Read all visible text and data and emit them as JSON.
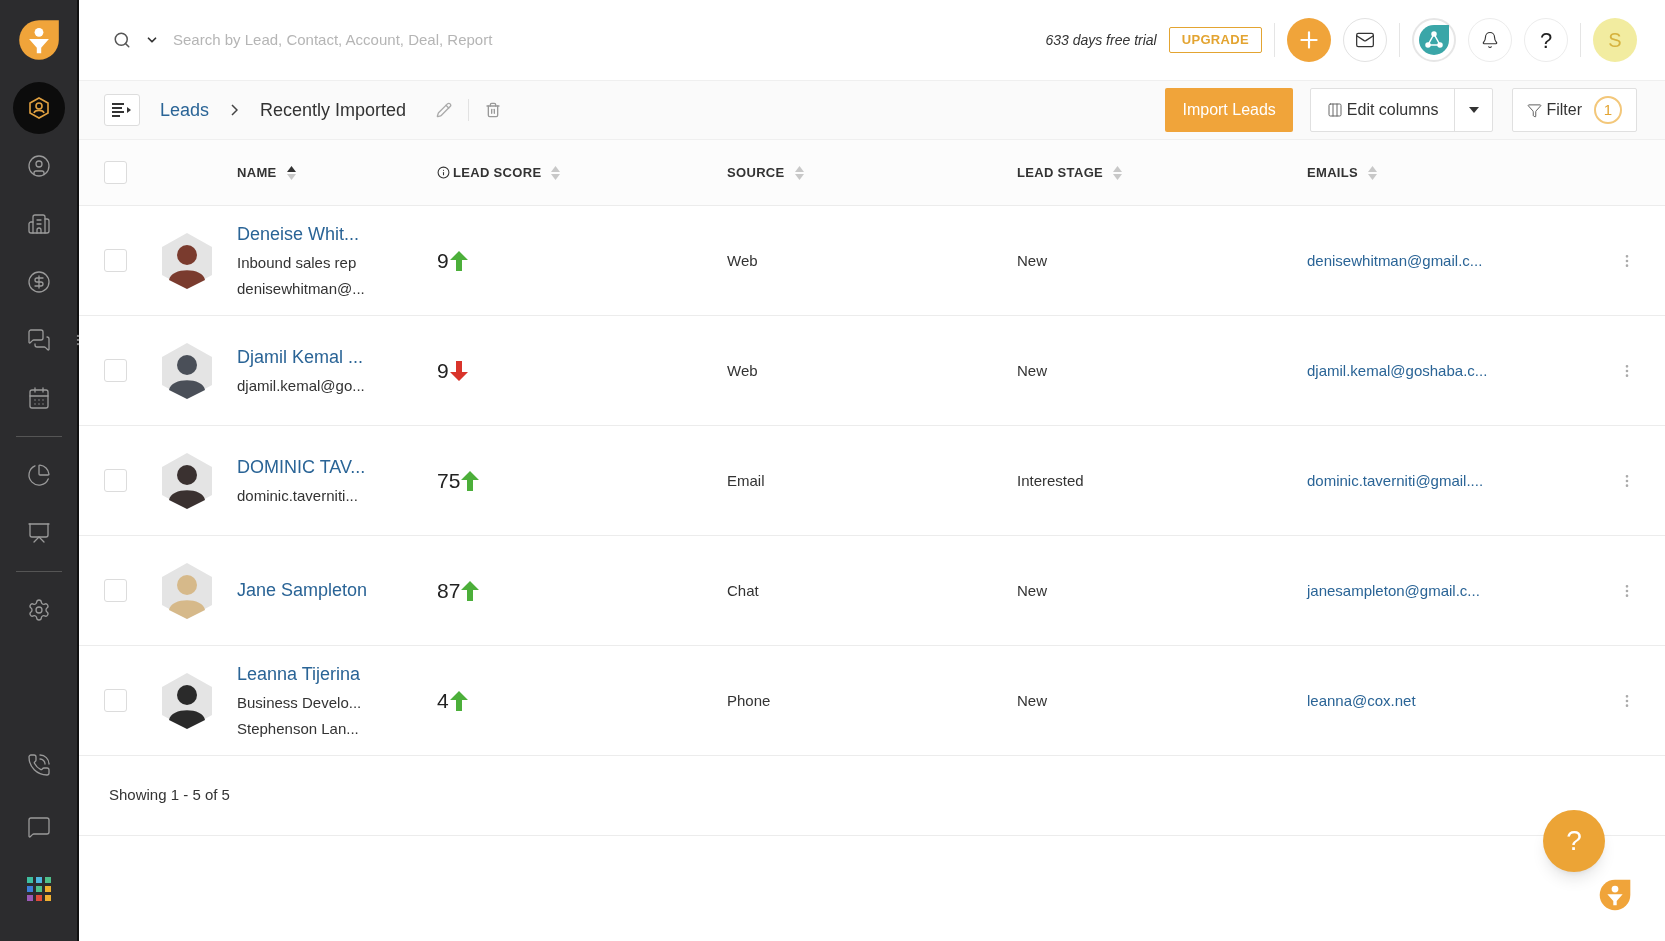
{
  "sidebar": {
    "groups": [
      [
        {
          "selected": true
        },
        {
          "selected": false
        },
        {
          "selected": false
        },
        {
          "selected": false
        },
        {
          "selected": false
        },
        {
          "selected": false
        }
      ],
      [
        {
          "selected": false
        },
        {
          "selected": false
        }
      ],
      [
        {
          "selected": false
        }
      ]
    ],
    "bottom": [
      {
        "selected": false
      },
      {
        "selected": false
      }
    ]
  },
  "top_bar": {
    "search": {
      "placeholder": "Search by Lead, Contact, Account, Deal, Report"
    },
    "trial": "633 days free trial",
    "upgrade": "UPGRADE",
    "help": "?",
    "user_initial": "S"
  },
  "breadcrumb": {
    "parent": "Leads",
    "current": "Recently Imported"
  },
  "actions": {
    "import": "Import Leads",
    "edit_columns": "Edit columns",
    "filter": "Filter",
    "filter_count": "1"
  },
  "table": {
    "all_checked": false,
    "columns": [
      {
        "label": "NAME",
        "sorted": true,
        "info": false
      },
      {
        "label": "LEAD SCORE",
        "sorted": false,
        "info": true
      },
      {
        "label": "SOURCE",
        "sorted": false,
        "info": false
      },
      {
        "label": "LEAD STAGE",
        "sorted": false,
        "info": false
      },
      {
        "label": "EMAILS",
        "sorted": false,
        "info": false
      }
    ],
    "rows": [
      {
        "checked": false,
        "name": "Deneise Whit...",
        "details": [
          "Inbound sales rep",
          "denisewhitman@..."
        ],
        "score": "9",
        "rising": true,
        "source": "Web",
        "stage": "New",
        "email": "denisewhitman@gmail.c..."
      },
      {
        "checked": false,
        "name": "Djamil Kemal ...",
        "details": [
          "djamil.kemal@go..."
        ],
        "score": "9",
        "rising": false,
        "source": "Web",
        "stage": "New",
        "email": "djamil.kemal@goshaba.c..."
      },
      {
        "checked": false,
        "name": "DOMINIC TAV...",
        "details": [
          "dominic.taverniti..."
        ],
        "score": "75",
        "rising": true,
        "source": "Email",
        "stage": "Interested",
        "email": "dominic.taverniti@gmail...."
      },
      {
        "checked": false,
        "name": "Jane Sampleton",
        "details": [],
        "score": "87",
        "rising": true,
        "source": "Chat",
        "stage": "New",
        "email": "janesampleton@gmail.c..."
      },
      {
        "checked": false,
        "name": "Leanna Tijerina",
        "details": [
          "Business Develo...",
          "Stephenson Lan..."
        ],
        "score": "4",
        "rising": true,
        "source": "Phone",
        "stage": "New",
        "email": "leanna@cox.net"
      }
    ]
  },
  "footer": "Showing 1 - 5 of 5",
  "help_fab": "?"
}
